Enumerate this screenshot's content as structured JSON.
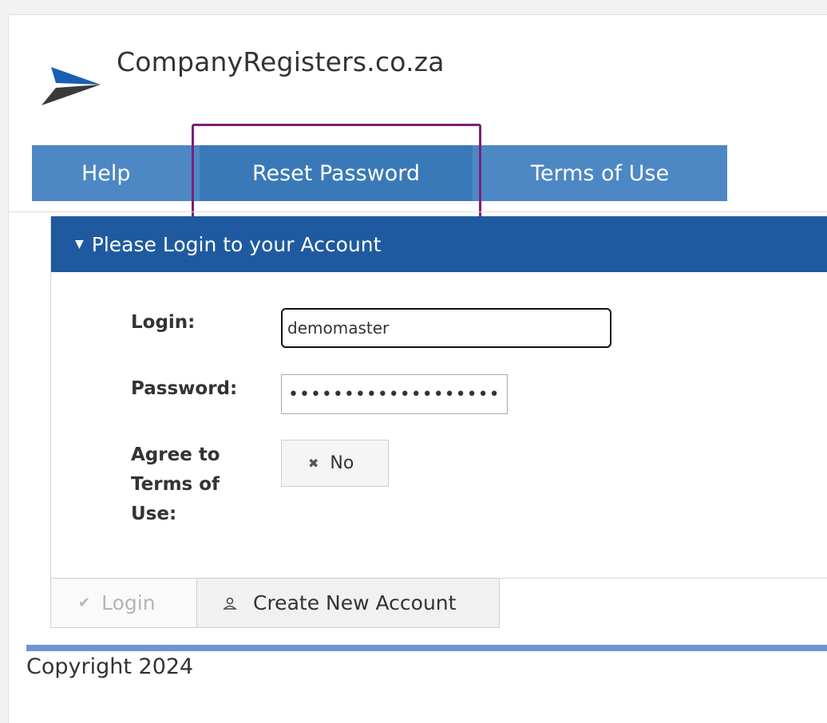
{
  "header": {
    "title": "CompanyRegisters.co.za",
    "logo_icon": "paper-plane-icon"
  },
  "nav": {
    "items": [
      {
        "label": "Help"
      },
      {
        "label": "Reset Password"
      },
      {
        "label": "Terms of Use"
      }
    ],
    "highlighted": "Reset Password"
  },
  "panel": {
    "title": "Please Login to your Account",
    "caret_icon": "caret-down-icon"
  },
  "form": {
    "login_label": "Login:",
    "login_value": "demomaster",
    "password_label": "Password:",
    "password_value": "••••••••••••••••••••",
    "agree_label_lines": [
      "Agree to",
      "Terms of",
      "Use:"
    ],
    "agree_toggle_label": "No",
    "agree_toggle_icon": "x-icon"
  },
  "buttons": {
    "login_label": "Login",
    "login_icon": "checkmark-icon",
    "create_label": "Create New Account",
    "create_icon": "user-icon"
  },
  "footer": {
    "copyright": "Copyright 2024"
  },
  "colors": {
    "nav_background": "#4d88c4",
    "panel_header": "#1f5aa0",
    "highlight_border": "#7b1f7a",
    "footer_line": "#6f93d6"
  }
}
